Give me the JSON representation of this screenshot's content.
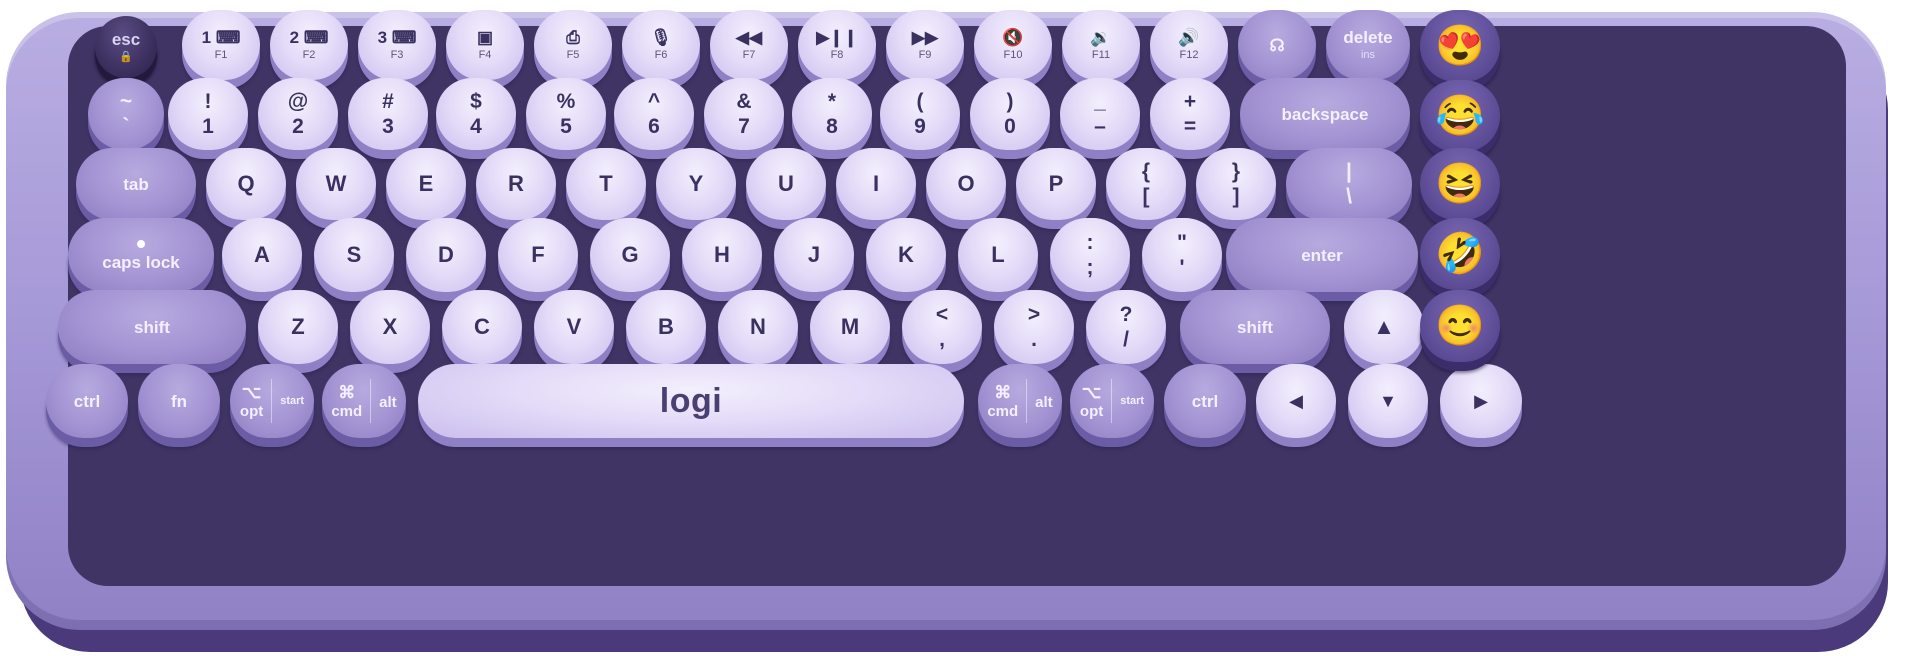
{
  "row_fn": [
    {
      "name": "key-esc",
      "main": "esc",
      "sub": "🔒",
      "style": "esc"
    },
    {
      "name": "key-f1",
      "main": "1 ⌨",
      "sub": "F1",
      "style": "light"
    },
    {
      "name": "key-f2",
      "main": "2 ⌨",
      "sub": "F2",
      "style": "light"
    },
    {
      "name": "key-f3",
      "main": "3 ⌨",
      "sub": "F3",
      "style": "light"
    },
    {
      "name": "key-f4",
      "main": "▣",
      "sub": "F4",
      "style": "light"
    },
    {
      "name": "key-f5",
      "main": "⎙",
      "sub": "F5",
      "style": "light"
    },
    {
      "name": "key-f6",
      "main": "🎙",
      "sub": "F6",
      "style": "light"
    },
    {
      "name": "key-f7",
      "main": "◀◀",
      "sub": "F7",
      "style": "light"
    },
    {
      "name": "key-f8",
      "main": "▶❙❙",
      "sub": "F8",
      "style": "light"
    },
    {
      "name": "key-f9",
      "main": "▶▶",
      "sub": "F9",
      "style": "light"
    },
    {
      "name": "key-f10",
      "main": "🔇",
      "sub": "F10",
      "style": "light"
    },
    {
      "name": "key-f11",
      "main": "🔉",
      "sub": "F11",
      "style": "light"
    },
    {
      "name": "key-f12",
      "main": "🔊",
      "sub": "F12",
      "style": "light"
    },
    {
      "name": "key-dictation",
      "main": "☊",
      "sub": "",
      "style": "mid"
    },
    {
      "name": "key-delete",
      "main": "delete",
      "sub": "ins",
      "style": "mid"
    }
  ],
  "row_num": [
    {
      "name": "key-tilde",
      "top": "~",
      "bot": "`",
      "style": "mid"
    },
    {
      "name": "key-1",
      "top": "!",
      "bot": "1",
      "style": "light"
    },
    {
      "name": "key-2",
      "top": "@",
      "bot": "2",
      "style": "light"
    },
    {
      "name": "key-3",
      "top": "#",
      "bot": "3",
      "style": "light"
    },
    {
      "name": "key-4",
      "top": "$",
      "bot": "4",
      "style": "light"
    },
    {
      "name": "key-5",
      "top": "%",
      "bot": "5",
      "style": "light"
    },
    {
      "name": "key-6",
      "top": "^",
      "bot": "6",
      "style": "light"
    },
    {
      "name": "key-7",
      "top": "&",
      "bot": "7",
      "style": "light"
    },
    {
      "name": "key-8",
      "top": "*",
      "bot": "8",
      "style": "light"
    },
    {
      "name": "key-9",
      "top": "(",
      "bot": "9",
      "style": "light"
    },
    {
      "name": "key-0",
      "top": ")",
      "bot": "0",
      "style": "light"
    },
    {
      "name": "key-minus",
      "top": "_",
      "bot": "–",
      "style": "light"
    },
    {
      "name": "key-equals",
      "top": "+",
      "bot": "=",
      "style": "light"
    },
    {
      "name": "key-backspace",
      "label": "backspace",
      "style": "mid"
    }
  ],
  "row_qwerty": [
    {
      "name": "key-tab",
      "label": "tab",
      "style": "mid"
    },
    {
      "name": "key-q",
      "label": "Q"
    },
    {
      "name": "key-w",
      "label": "W"
    },
    {
      "name": "key-e",
      "label": "E"
    },
    {
      "name": "key-r",
      "label": "R"
    },
    {
      "name": "key-t",
      "label": "T"
    },
    {
      "name": "key-y",
      "label": "Y"
    },
    {
      "name": "key-u",
      "label": "U"
    },
    {
      "name": "key-i",
      "label": "I"
    },
    {
      "name": "key-o",
      "label": "O"
    },
    {
      "name": "key-p",
      "label": "P"
    },
    {
      "name": "key-lbracket",
      "top": "{",
      "bot": "["
    },
    {
      "name": "key-rbracket",
      "top": "}",
      "bot": "]"
    },
    {
      "name": "key-backslash",
      "top": "|",
      "bot": "\\",
      "style": "mid"
    }
  ],
  "row_home": [
    {
      "name": "key-capslock",
      "label": "caps lock",
      "style": "mid"
    },
    {
      "name": "key-a",
      "label": "A"
    },
    {
      "name": "key-s",
      "label": "S"
    },
    {
      "name": "key-d",
      "label": "D"
    },
    {
      "name": "key-f",
      "label": "F"
    },
    {
      "name": "key-g",
      "label": "G"
    },
    {
      "name": "key-h",
      "label": "H"
    },
    {
      "name": "key-j",
      "label": "J"
    },
    {
      "name": "key-k",
      "label": "K"
    },
    {
      "name": "key-l",
      "label": "L"
    },
    {
      "name": "key-semicolon",
      "top": ":",
      "bot": ";"
    },
    {
      "name": "key-quote",
      "top": "\"",
      "bot": "'"
    },
    {
      "name": "key-enter",
      "label": "enter",
      "style": "mid"
    }
  ],
  "row_shift": [
    {
      "name": "key-shift-left",
      "label": "shift",
      "style": "mid"
    },
    {
      "name": "key-z",
      "label": "Z"
    },
    {
      "name": "key-x",
      "label": "X"
    },
    {
      "name": "key-c",
      "label": "C"
    },
    {
      "name": "key-v",
      "label": "V"
    },
    {
      "name": "key-b",
      "label": "B"
    },
    {
      "name": "key-n",
      "label": "N"
    },
    {
      "name": "key-m",
      "label": "M"
    },
    {
      "name": "key-comma",
      "top": "<",
      "bot": ","
    },
    {
      "name": "key-period",
      "top": ">",
      "bot": "."
    },
    {
      "name": "key-slash",
      "top": "?",
      "bot": "/"
    },
    {
      "name": "key-shift-right",
      "label": "shift",
      "style": "mid"
    },
    {
      "name": "key-arrow-up",
      "label": "▲"
    }
  ],
  "row_bottom": {
    "ctrl": "ctrl",
    "fn": "fn",
    "opt_glyph": "⌥",
    "opt": "opt",
    "start": "start",
    "cmd_glyph": "⌘",
    "cmd": "cmd",
    "alt": "alt",
    "space_logo": "logi",
    "arrow_left": "◀",
    "arrow_down": "▼",
    "arrow_right": "▶"
  },
  "emoji_keys": [
    "😍",
    "😂",
    "😆",
    "🤣",
    "😊"
  ],
  "colors": {
    "body": "#a99cda",
    "key_light": "#e4dcf8",
    "key_mid": "#a393d3",
    "key_dark": "#62519b",
    "plate": "#3f3464"
  }
}
